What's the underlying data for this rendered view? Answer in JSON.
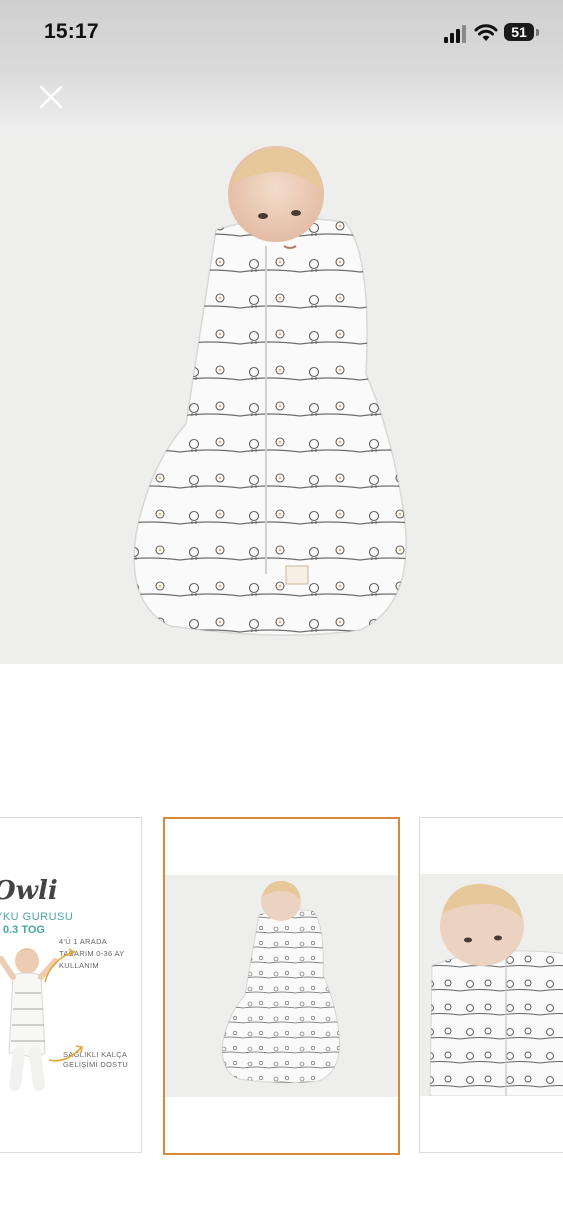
{
  "status_bar": {
    "time": "15:17",
    "battery": "51",
    "icons": [
      "signal-icon",
      "wifi-icon",
      "battery-icon"
    ]
  },
  "top_bar": {
    "close_icon": "close-icon"
  },
  "gallery": {
    "main_image": "baby-swaddle-sack-photo",
    "thumbnails": [
      {
        "name": "promo-thumbnail",
        "logo": "Owli",
        "title": "YKU GURUSU",
        "tog": "0.3 TOG",
        "note1": "4'Ü 1 ARADA TASARIM 0-36 AY KULLANIM",
        "note2": "SAĞLIKLI KALÇA GELİŞİMİ DOSTU",
        "selected": false
      },
      {
        "name": "swaddle-full-thumbnail",
        "selected": true
      },
      {
        "name": "baby-closeup-thumbnail",
        "selected": false
      }
    ]
  },
  "colors": {
    "selected_border": "#d88a3a",
    "promo_accent": "#4aa7a8",
    "background": "#eeeeec"
  }
}
